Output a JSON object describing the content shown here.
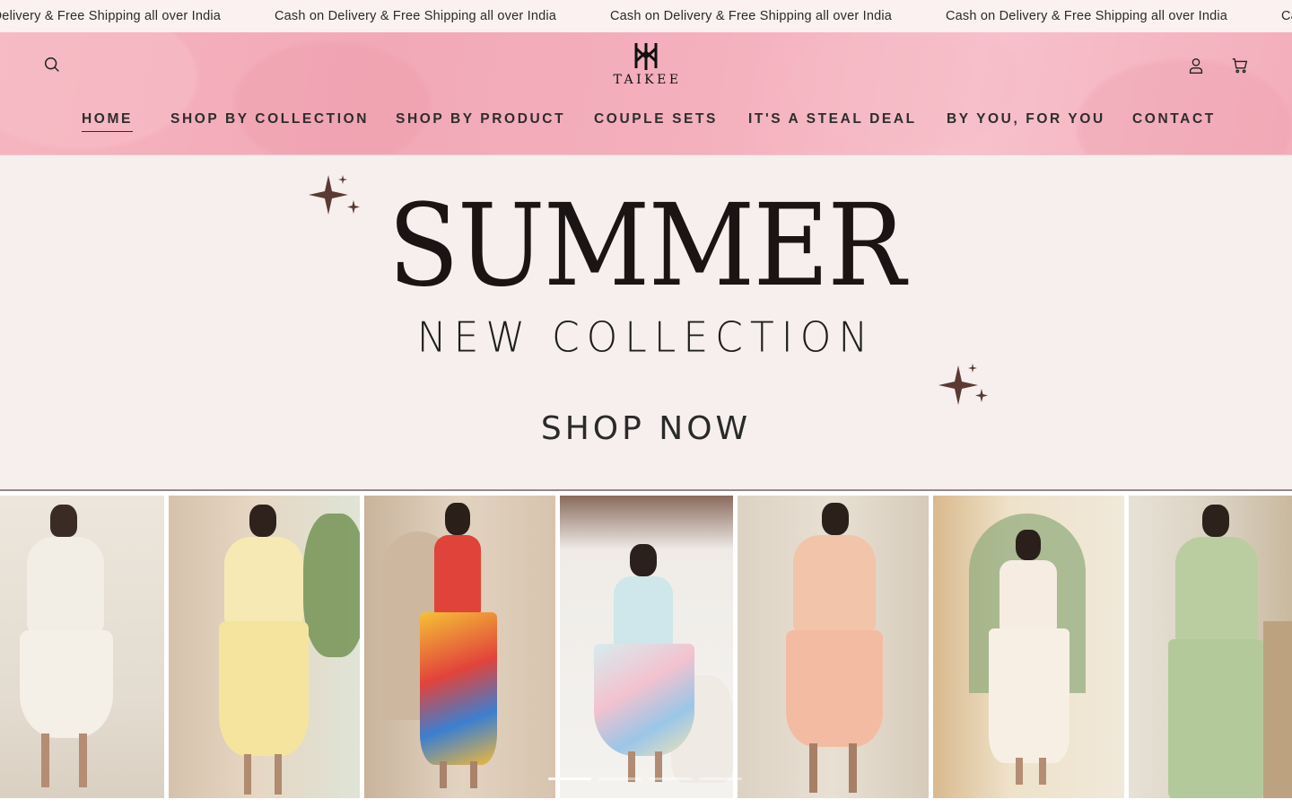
{
  "announcement": {
    "items": [
      "Cash on Delivery & Free Shipping all over India",
      "Cash on Delivery & Free Shipping all over India",
      "Cash on Delivery & Free Shipping all over India",
      "Cash on Delivery & Free Shipping all over India",
      "Cash on Delivery & Free Shipping all over India"
    ]
  },
  "header": {
    "brand": "TAIKEE",
    "icons": {
      "search": "search-icon",
      "account": "user-icon",
      "cart": "cart-icon"
    },
    "nav": [
      {
        "label": "HOME",
        "active": true
      },
      {
        "label": "SHOP BY COLLECTION",
        "active": false
      },
      {
        "label": "SHOP BY PRODUCT",
        "active": false
      },
      {
        "label": "COUPLE SETS",
        "active": false
      },
      {
        "label": "IT'S A STEAL DEAL",
        "active": false
      },
      {
        "label": "BY YOU, FOR YOU",
        "active": false
      },
      {
        "label": "CONTACT",
        "active": false
      }
    ]
  },
  "hero": {
    "title": "SUMMER",
    "subtitle": "NEW COLLECTION",
    "cta": "SHOP NOW"
  },
  "gallery": {
    "slide_count": 4,
    "active_slide": 1
  },
  "colors": {
    "header_pink": "#f2a9b7",
    "hero_bg": "#f6efee",
    "announce_bg": "#fbf1f1",
    "sparkle": "#5b3a33",
    "text_dark": "#1c1c1c"
  }
}
